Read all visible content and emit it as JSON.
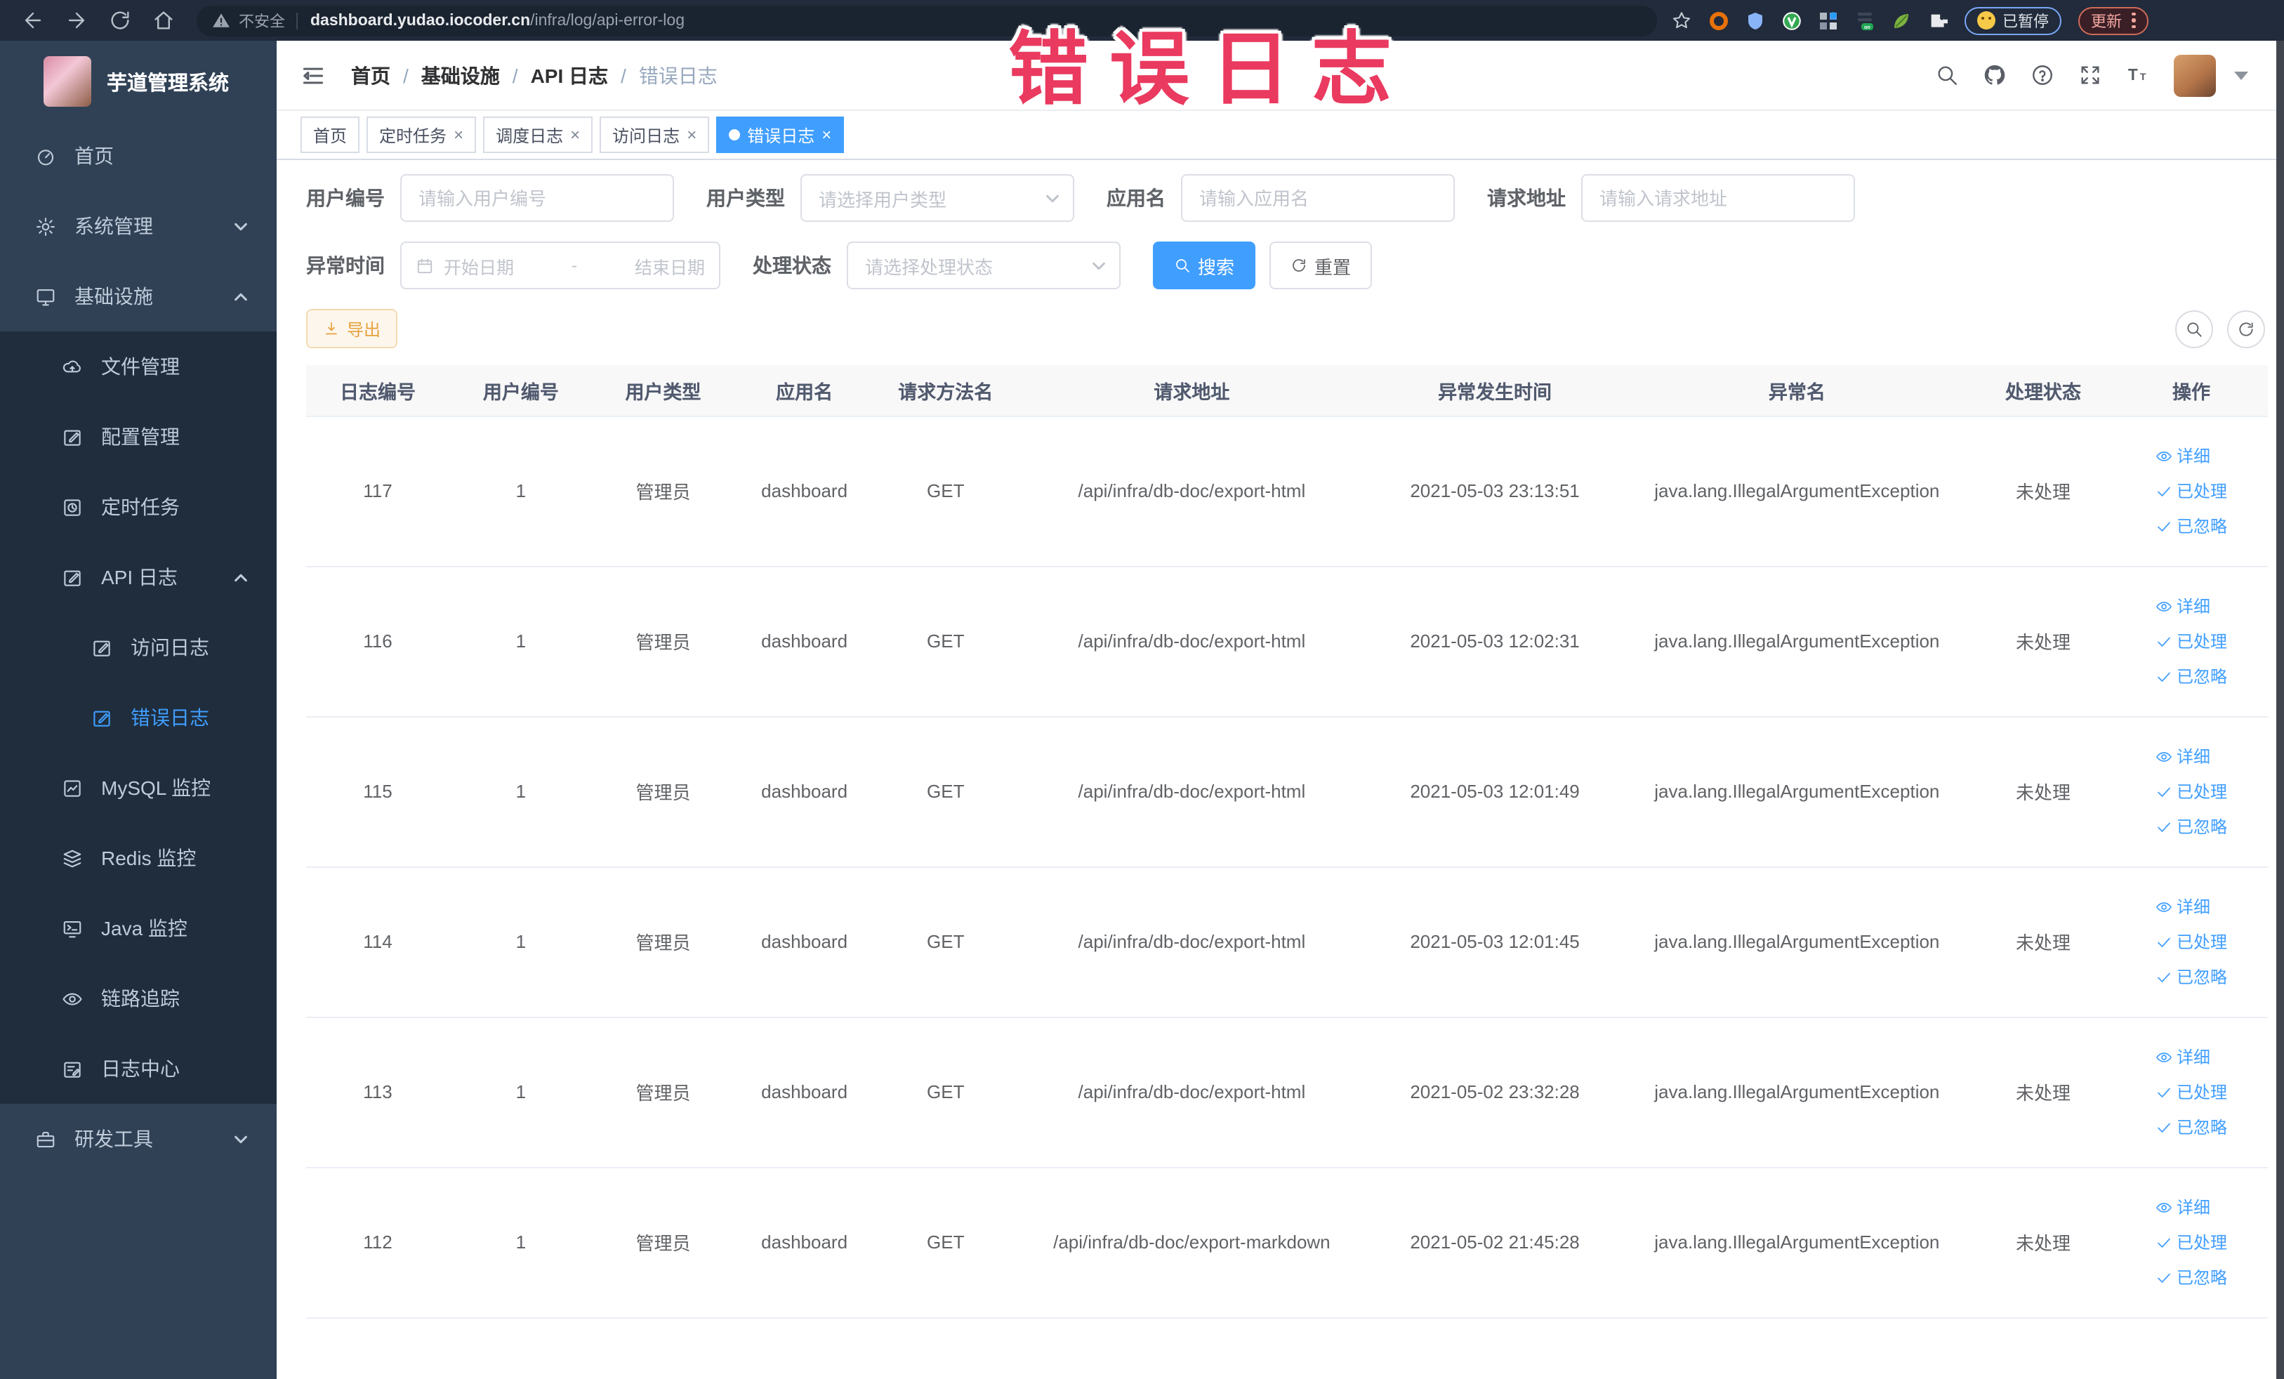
{
  "browser": {
    "security_text": "不安全",
    "url_host": "dashboard.yudao.iocoder.cn",
    "url_path": "/infra/log/api-error-log",
    "paused_label": "已暂停",
    "update_label": "更新"
  },
  "annotation": {
    "text": "错误日志",
    "color": "#ea3a5f"
  },
  "sidebar": {
    "title": "芋道管理系统",
    "items": [
      "首页",
      "系统管理",
      "基础设施",
      "文件管理",
      "配置管理",
      "定时任务",
      "API 日志",
      "访问日志",
      "错误日志",
      "MySQL 监控",
      "Redis 监控",
      "Java 监控",
      "链路追踪",
      "日志中心",
      "研发工具"
    ]
  },
  "breadcrumb": {
    "items": [
      "首页",
      "基础设施",
      "API 日志",
      "错误日志"
    ],
    "separator": "/"
  },
  "tags": [
    "首页",
    "定时任务",
    "调度日志",
    "访问日志",
    "错误日志"
  ],
  "filters": {
    "user_id_label": "用户编号",
    "user_id_placeholder": "请输入用户编号",
    "user_type_label": "用户类型",
    "user_type_placeholder": "请选择用户类型",
    "app_name_label": "应用名",
    "app_name_placeholder": "请输入应用名",
    "request_url_label": "请求地址",
    "request_url_placeholder": "请输入请求地址",
    "time_label": "异常时间",
    "time_start_placeholder": "开始日期",
    "time_separator": "-",
    "time_end_placeholder": "结束日期",
    "status_label": "处理状态",
    "status_placeholder": "请选择处理状态",
    "search_label": "搜索",
    "reset_label": "重置"
  },
  "toolbar": {
    "export_label": "导出"
  },
  "table": {
    "columns": [
      "日志编号",
      "用户编号",
      "用户类型",
      "应用名",
      "请求方法名",
      "请求地址",
      "异常发生时间",
      "异常名",
      "处理状态",
      "操作"
    ],
    "actions": {
      "detail": "详细",
      "processed": "已处理",
      "ignored": "已忽略"
    },
    "rows": [
      {
        "id": "117",
        "user_id": "1",
        "user_type": "管理员",
        "app_name": "dashboard",
        "method": "GET",
        "url": "/api/infra/db-doc/export-html",
        "time": "2021-05-03 23:13:51",
        "exception": "java.lang.IllegalArgumentException",
        "status": "未处理"
      },
      {
        "id": "116",
        "user_id": "1",
        "user_type": "管理员",
        "app_name": "dashboard",
        "method": "GET",
        "url": "/api/infra/db-doc/export-html",
        "time": "2021-05-03 12:02:31",
        "exception": "java.lang.IllegalArgumentException",
        "status": "未处理"
      },
      {
        "id": "115",
        "user_id": "1",
        "user_type": "管理员",
        "app_name": "dashboard",
        "method": "GET",
        "url": "/api/infra/db-doc/export-html",
        "time": "2021-05-03 12:01:49",
        "exception": "java.lang.IllegalArgumentException",
        "status": "未处理"
      },
      {
        "id": "114",
        "user_id": "1",
        "user_type": "管理员",
        "app_name": "dashboard",
        "method": "GET",
        "url": "/api/infra/db-doc/export-html",
        "time": "2021-05-03 12:01:45",
        "exception": "java.lang.IllegalArgumentException",
        "status": "未处理"
      },
      {
        "id": "113",
        "user_id": "1",
        "user_type": "管理员",
        "app_name": "dashboard",
        "method": "GET",
        "url": "/api/infra/db-doc/export-html",
        "time": "2021-05-02 23:32:28",
        "exception": "java.lang.IllegalArgumentException",
        "status": "未处理"
      },
      {
        "id": "112",
        "user_id": "1",
        "user_type": "管理员",
        "app_name": "dashboard",
        "method": "GET",
        "url": "/api/infra/db-doc/export-markdown",
        "time": "2021-05-02 21:45:28",
        "exception": "java.lang.IllegalArgumentException",
        "status": "未处理"
      }
    ]
  },
  "colors": {
    "accent": "#409eff",
    "warning": "#e6a23c",
    "sidebar_bg": "#304156",
    "submenu_bg": "#1f2d3d",
    "annotation": "#ea3a5f"
  }
}
